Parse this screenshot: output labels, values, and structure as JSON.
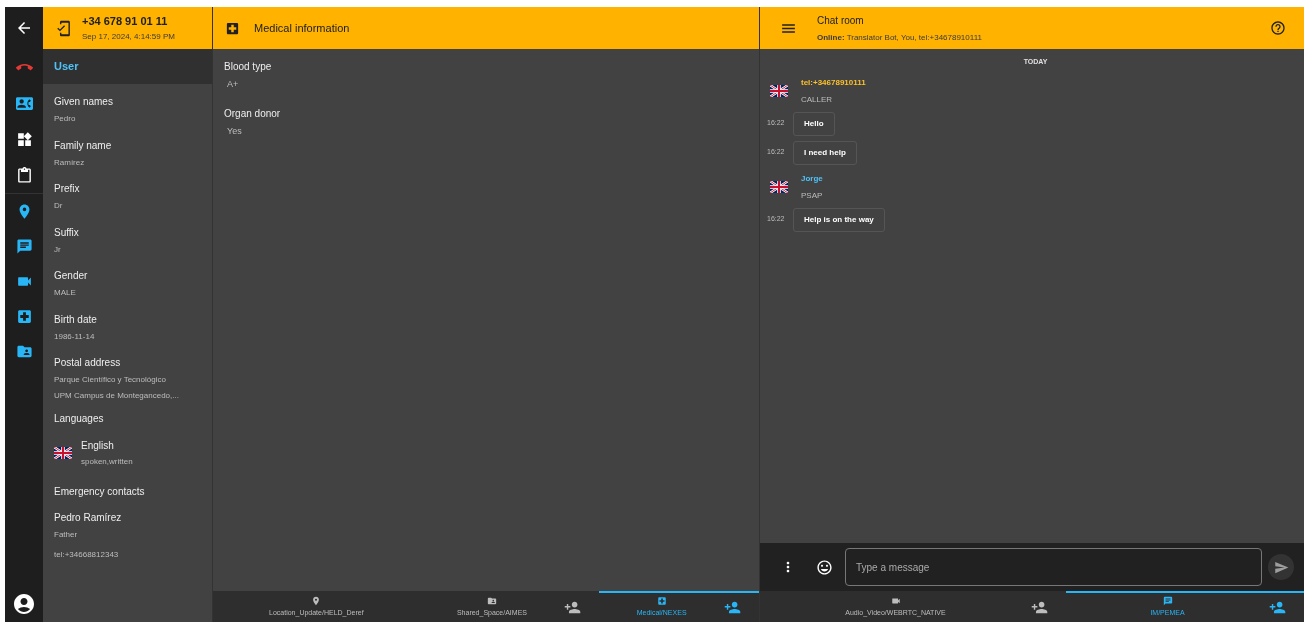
{
  "call_header": {
    "phone": "+34 678 91 01 11",
    "datetime": "Sep 17, 2024, 4:14:59 PM"
  },
  "user_panel": {
    "title": "User",
    "fields": [
      {
        "label": "Given names",
        "lines": [
          "Pedro"
        ]
      },
      {
        "label": "Family name",
        "lines": [
          "Ramírez"
        ]
      },
      {
        "label": "Prefix",
        "lines": [
          "Dr"
        ]
      },
      {
        "label": "Suffix",
        "lines": [
          "Jr"
        ]
      },
      {
        "label": "Gender",
        "lines": [
          "MALE"
        ]
      },
      {
        "label": "Birth date",
        "lines": [
          "1986-11-14"
        ]
      },
      {
        "label": "Postal address",
        "lines": [
          "Parque Científico y Tecnológico",
          "UPM Campus de Montegancedo,..."
        ]
      }
    ],
    "languages_heading": "Languages",
    "languages": [
      {
        "name": "English",
        "detail": "spoken,written"
      }
    ],
    "contacts_heading": "Emergency contacts",
    "contacts": [
      {
        "name": "Pedro Ramírez",
        "relation": "Father",
        "tel": "tel:+34668812343"
      }
    ]
  },
  "medical": {
    "title": "Medical information",
    "fields": [
      {
        "label": "Blood type",
        "value": "A+"
      },
      {
        "label": "Organ donor",
        "value": "Yes"
      }
    ]
  },
  "chat": {
    "title": "Chat room",
    "online_label": "Online:",
    "online_value": "Translator Bot, You, tel:+34678910111",
    "day": "TODAY",
    "items": [
      {
        "kind": "sender",
        "name": "tel:+34678910111",
        "role": "CALLER",
        "color": "#fbc02d"
      },
      {
        "kind": "message",
        "time": "16:22",
        "text": "Hello"
      },
      {
        "kind": "message",
        "time": "16:22",
        "text": "I need help"
      },
      {
        "kind": "sender",
        "name": "Jorge",
        "role": "PSAP",
        "color": "#4fc3f7"
      },
      {
        "kind": "message",
        "time": "16:22",
        "text": "Help is on the way"
      }
    ],
    "input": {
      "placeholder": "Type a message"
    }
  },
  "left_tabs": [
    {
      "kind": "location",
      "label": "Location_Update/HELD_Deref",
      "selected": false,
      "invite": false
    },
    {
      "kind": "shared",
      "label": "Shared_Space/AIMES",
      "selected": false,
      "invite": true
    },
    {
      "kind": "medical",
      "label": "Medical/NEXES",
      "selected": true,
      "invite": true
    }
  ],
  "right_tabs": [
    {
      "kind": "video",
      "label": "Audio_Video/WEBRTC_NATIVE",
      "selected": false,
      "invite": true
    },
    {
      "kind": "chat",
      "label": "IM/PEMEA",
      "selected": true,
      "invite": true
    }
  ]
}
